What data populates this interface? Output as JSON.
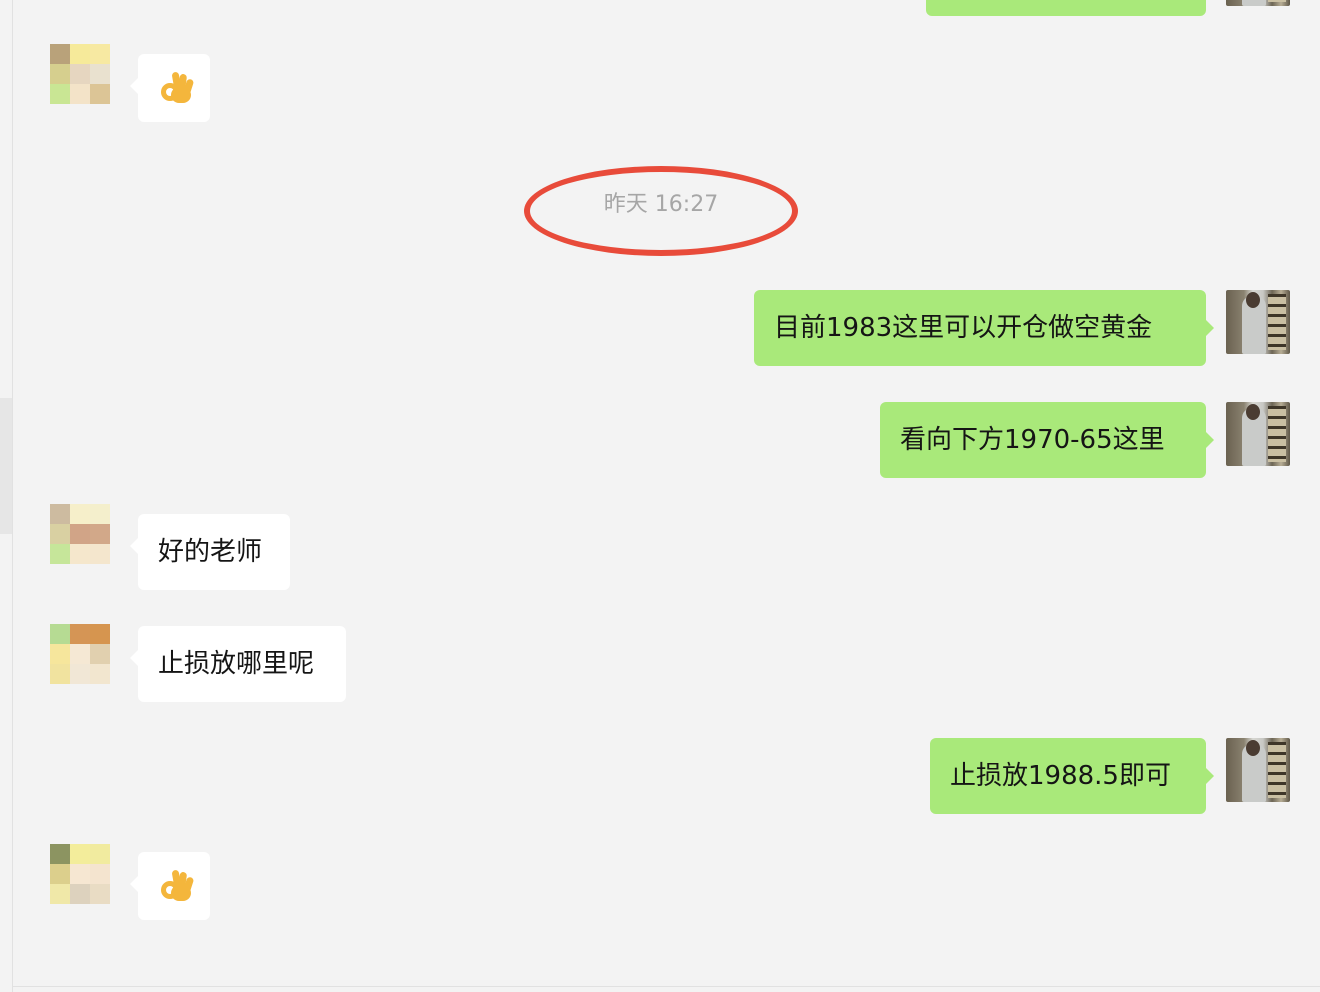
{
  "conversation": {
    "timestamp": "昨天 16:27",
    "messages": [
      {
        "from": "other",
        "type": "emoji",
        "emoji": "ok-hand-icon"
      },
      {
        "from": "me",
        "type": "text",
        "text": "目前1983这里可以开仓做空黄金"
      },
      {
        "from": "me",
        "type": "text",
        "text": "看向下方1970-65这里"
      },
      {
        "from": "other",
        "type": "text",
        "text": "好的老师"
      },
      {
        "from": "other",
        "type": "text",
        "text": "止损放哪里呢"
      },
      {
        "from": "me",
        "type": "text",
        "text": "止损放1988.5即可"
      },
      {
        "from": "other",
        "type": "emoji",
        "emoji": "ok-hand-icon"
      }
    ]
  },
  "colors": {
    "background": "#f3f3f3",
    "outgoing_bubble": "#a9e97a",
    "incoming_bubble": "#ffffff",
    "timestamp_text": "#a6a6a6",
    "annotation_ring": "#e84b3a"
  }
}
